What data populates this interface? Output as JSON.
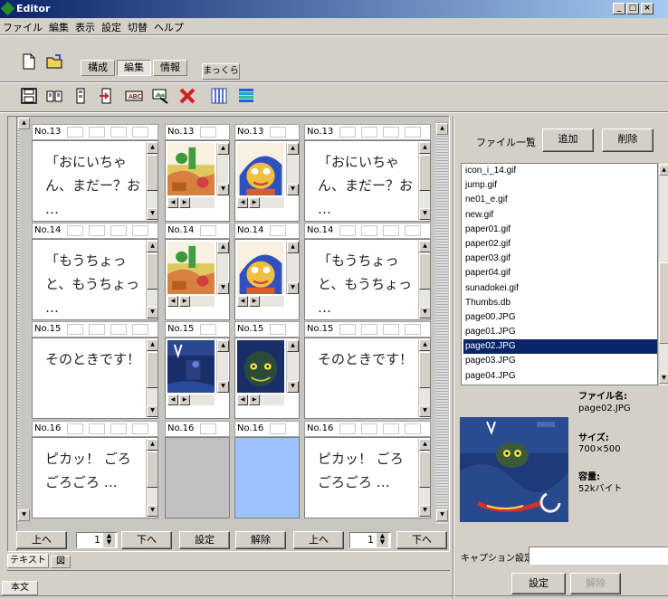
{
  "window": {
    "title": "Editor",
    "min": "_",
    "max": "□",
    "close": "×"
  },
  "menu": [
    "ファイル",
    "編集",
    "表示",
    "設定",
    "切替",
    "ヘルプ"
  ],
  "toolbar": {
    "tabs": [
      "構成",
      "編集",
      "情報"
    ],
    "extra": "まっくら"
  },
  "grid": {
    "rows": [
      {
        "cells": [
          {
            "label": "No.13",
            "type": "text",
            "text": "「おにいちゃ\nん、まだー？お\n…"
          },
          {
            "label": "No.13",
            "type": "image",
            "image": "colorful-scene"
          },
          {
            "label": "No.13",
            "type": "image",
            "image": "colorful-face"
          },
          {
            "label": "No.13",
            "type": "text",
            "text": "「おにいちゃ\nん、まだー？お\n…"
          }
        ]
      },
      {
        "cells": [
          {
            "label": "No.14",
            "type": "text",
            "text": "「もうちょっ\nと、もうちょっ\n…"
          },
          {
            "label": "No.14",
            "type": "image",
            "image": "colorful-scene"
          },
          {
            "label": "No.14",
            "type": "image",
            "image": "colorful-face"
          },
          {
            "label": "No.14",
            "type": "text",
            "text": "「もうちょっ\nと、もうちょっ\n…"
          }
        ]
      },
      {
        "cells": [
          {
            "label": "No.15",
            "type": "text",
            "text": "そのときです！"
          },
          {
            "label": "No.15",
            "type": "image",
            "image": "dark-scene"
          },
          {
            "label": "No.15",
            "type": "image",
            "image": "dark-creature"
          },
          {
            "label": "No.15",
            "type": "text",
            "text": "そのときです！"
          }
        ]
      },
      {
        "cells": [
          {
            "label": "No.16",
            "type": "text",
            "text": "ピカッ！ ごろ\nごろごろ …"
          },
          {
            "label": "No.16",
            "type": "blank",
            "color": "#c0c0c0"
          },
          {
            "label": "No.16",
            "type": "blank",
            "color": "#9ec1ff"
          },
          {
            "label": "No.16",
            "type": "text",
            "text": "ピカッ！ ごろ\nごろごろ …"
          }
        ]
      }
    ]
  },
  "bottom": {
    "up_left": "上へ",
    "spin_left": "1",
    "down_left": "下へ",
    "set": "設定",
    "clear": "解除",
    "up_right": "上へ",
    "spin_right": "1",
    "down_right": "下へ"
  },
  "bottom_tabs": [
    "テキスト",
    "図"
  ],
  "status": "本文",
  "files": {
    "header": "ファイル一覧",
    "add": "追加",
    "delete": "削除",
    "items": [
      "icon_i_14.gif",
      "jump.gif",
      "ne01_e.gif",
      "new.gif",
      "paper01.gif",
      "paper02.gif",
      "paper03.gif",
      "paper04.gif",
      "sunadokei.gif",
      "Thumbs.db",
      "page00.JPG",
      "page01.JPG",
      "page02.JPG",
      "page03.JPG",
      "page04.JPG"
    ],
    "selected_index": 12
  },
  "preview": {
    "filename_label": "ファイル名:",
    "filename": "page02.JPG",
    "size_label": "サイズ:",
    "size": "700×500",
    "capacity_label": "容量:",
    "capacity": "52kバイト"
  },
  "caption": {
    "label": "キャプション設定",
    "value": ""
  },
  "right_buttons": {
    "set": "設定",
    "clear": "解除"
  },
  "colors": {
    "selection": "#0a246a",
    "face": "#d4d0c8",
    "blank_blue": "#9ec1ff"
  }
}
